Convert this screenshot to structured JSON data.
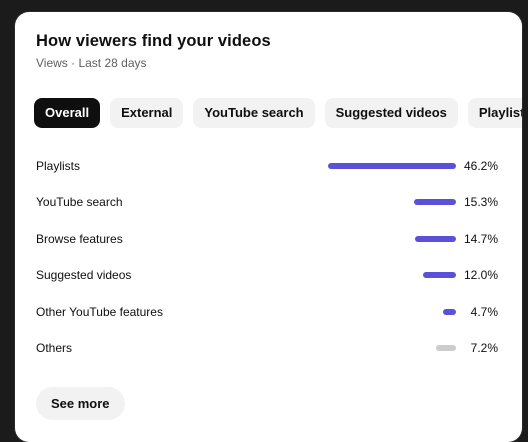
{
  "card": {
    "title": "How viewers find your videos",
    "subtitle": "Views · Last 28 days"
  },
  "tabs": [
    {
      "label": "Overall",
      "active": true
    },
    {
      "label": "External",
      "active": false
    },
    {
      "label": "YouTube search",
      "active": false
    },
    {
      "label": "Suggested videos",
      "active": false
    },
    {
      "label": "Playlists",
      "active": false
    }
  ],
  "chart_data": {
    "type": "bar",
    "categories": [
      "Playlists",
      "YouTube search",
      "Browse features",
      "Suggested videos",
      "Other YouTube features",
      "Others"
    ],
    "values": [
      46.2,
      15.3,
      14.7,
      12.0,
      4.7,
      7.2
    ],
    "value_labels": [
      "46.2%",
      "15.3%",
      "14.7%",
      "12.0%",
      "4.7%",
      "7.2%"
    ],
    "colors": [
      "#5b51d8",
      "#5b51d8",
      "#5b51d8",
      "#5b51d8",
      "#5b51d8",
      "#cccccc"
    ],
    "unit": "%"
  },
  "footer": {
    "see_more_label": "See more"
  }
}
